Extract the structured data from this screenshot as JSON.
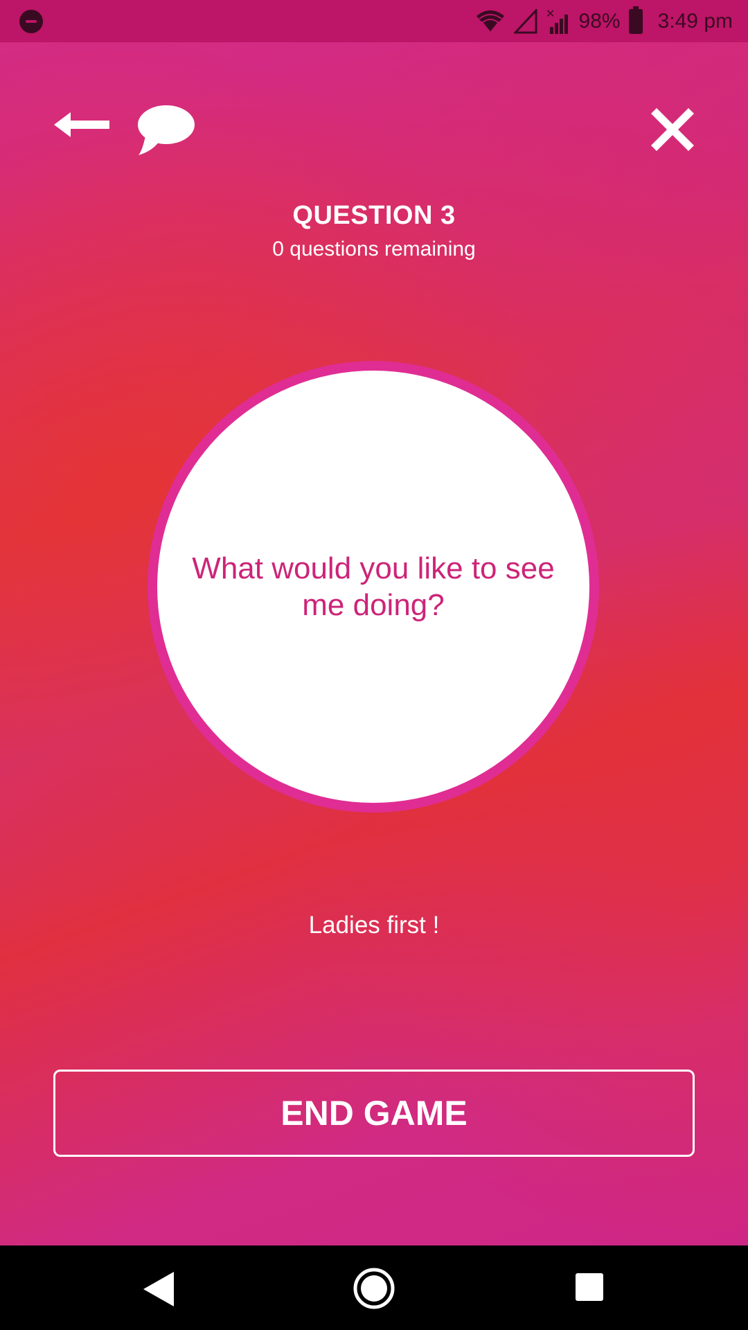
{
  "status_bar": {
    "battery": "98%",
    "time": "3:49 pm",
    "icons": [
      "do-not-disturb-icon",
      "wifi-icon",
      "signal-icon",
      "no-signal-icon",
      "battery-icon"
    ]
  },
  "header": {
    "back_icon": "arrow-left-icon",
    "chat_icon": "speech-bubble-icon",
    "close_icon": "close-x-icon"
  },
  "question": {
    "title": "QUESTION 3",
    "remaining": "0 questions remaining",
    "text": "What would you like to see me doing?"
  },
  "turn_text": "Ladies first !",
  "end_button_label": "END GAME",
  "colors": {
    "gradient_pink": "#d42b83",
    "gradient_red": "#e03446",
    "status_bar": "#bd1567",
    "circle_ring": "#e02d93",
    "question_text": "#cc2478",
    "nav_bar": "#000000"
  },
  "nav_bar": {
    "icons": [
      "nav-back-icon",
      "nav-home-icon",
      "nav-recents-icon"
    ]
  }
}
